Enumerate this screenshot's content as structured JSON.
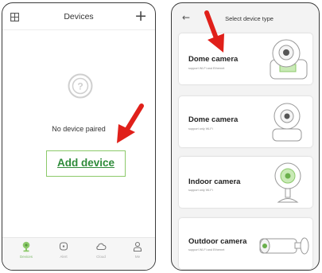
{
  "left_screen": {
    "header": {
      "title": "Devices"
    },
    "empty_state": {
      "message": "No device paired",
      "button_label": "Add device"
    },
    "tabs": [
      {
        "label": "Devices",
        "icon": "devices-icon",
        "active": true
      },
      {
        "label": "Alert",
        "icon": "alert-icon",
        "active": false
      },
      {
        "label": "Cloud",
        "icon": "cloud-icon",
        "active": false
      },
      {
        "label": "Me",
        "icon": "user-icon",
        "active": false
      }
    ]
  },
  "right_screen": {
    "header": {
      "back_icon": "back-arrow-icon",
      "title": "Select device type"
    },
    "device_types": [
      {
        "title": "Dome camera",
        "subtitle": "support Wi-Fi and Ethernet",
        "image": "dome-camera-ethernet"
      },
      {
        "title": "Dome camera",
        "subtitle": "support only Wi-Fi",
        "image": "dome-camera-wifi"
      },
      {
        "title": "Indoor camera",
        "subtitle": "support only Wi-Fi",
        "image": "indoor-camera"
      },
      {
        "title": "Outdoor camera",
        "subtitle": "support Wi-Fi and Ethernet",
        "image": "outdoor-camera"
      }
    ]
  },
  "colors": {
    "accent_green": "#2e8b3a",
    "border_green": "#8cc96a",
    "arrow_red": "#e0201a"
  }
}
